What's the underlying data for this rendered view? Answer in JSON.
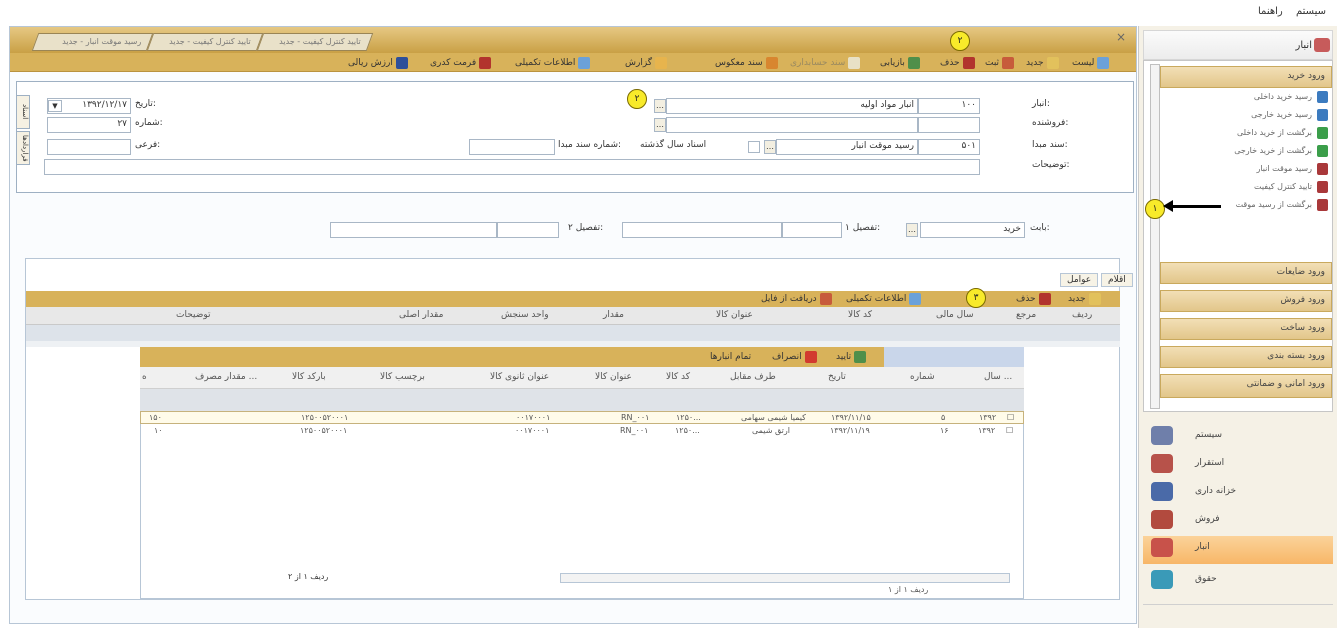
{
  "menubar": {
    "items": [
      "سیستم",
      "راهنما"
    ]
  },
  "tabs": [
    {
      "label": "رسید موقت انبار - جدید"
    },
    {
      "label": "تایید کنترل کیفیت - جدید"
    },
    {
      "label": "تایید کنترل کیفیت - جدید"
    }
  ],
  "toolbar": {
    "items": [
      "لیست",
      "جدید",
      "ثبت",
      "حذف",
      "بازیابی",
      "سند حسابداری",
      "سند معکوس",
      "گزارش",
      "اطلاعات تکمیلی",
      "فرمت کدری",
      "ارزش ریالی"
    ]
  },
  "form": {
    "labels": {
      "store": "انبار:",
      "seller": "فروشنده:",
      "source_doc": "سند مبدا:",
      "description": "توضیحات:",
      "date": "تاریخ:",
      "number": "شماره:",
      "temp": "فرعی:",
      "prev_year": "اسناد سال گذشته",
      "source_doc_num": "شماره سند مبدا:"
    },
    "store_code": "۱۰۰",
    "store_name": "انبار مواد اولیه",
    "source_code": "۵۰۱",
    "source_name": "رسید موقت انبار",
    "date": "۱۳۹۲/۱۲/۱۷",
    "number": "۲۷",
    "side_tabs": [
      "اسناد",
      "قراردادها"
    ]
  },
  "filter_row": {
    "label1": "بابت:",
    "value1": "خرید",
    "label2": "تفصیل ۱:",
    "label3": "تفصیل ۲:"
  },
  "item_tabs": [
    "اقلام",
    "عوامل"
  ],
  "grid_toolbar": {
    "items": [
      "جدید",
      "حذف",
      "اطلاعات تکمیلی",
      "دریافت از فایل"
    ]
  },
  "grid_head": [
    "ردیف",
    "مرجع",
    "سال مالی",
    "کد کالا",
    "عنوان کالا",
    "مقدار",
    "واحد سنجش",
    "مقدار اصلی",
    "توضیحات"
  ],
  "popup": {
    "toolbar": [
      "تایید",
      "انصراف",
      "تمام انبارها"
    ],
    "head": [
      "سال ...",
      "شماره",
      "تاریخ",
      "طرف مقابل",
      "کد کالا",
      "عنوان کالا",
      "عنوان ثانوی کالا",
      "برچسب کالا",
      "بارکد کالا",
      "مقدار مصرف ...",
      "ه"
    ],
    "rows": [
      {
        "year": "۱۳۹۲",
        "num": "۵",
        "date": "۱۳۹۲/۱۱/۱۵",
        "party": "کیمیا شیمی سهامی",
        "code": "۱۲۵۰...",
        "title": "RN_۰۰۱",
        "title2": "۰۰۱۷۰۰۰۱",
        "barcode": "۱۲۵۰۰۵۲۰۰۰۱",
        "qty": "۱۵۰"
      },
      {
        "year": "۱۳۹۲",
        "num": "۱۶",
        "date": "۱۳۹۲/۱۱/۱۹",
        "party": "ارتق شیمی",
        "code": "۱۲۵۰...",
        "title": "RN_۰۰۱",
        "title2": "۰۰۱۷۰۰۰۱",
        "barcode": "۱۲۵۰۰۵۲۰۰۰۱",
        "qty": "۱۰"
      }
    ],
    "pager": "ردیف ۱ از ۲"
  },
  "status": "ردیف ۱ از ۱",
  "sidebar": {
    "title": "انبار",
    "sections": [
      "ورود خرید",
      "ورود ضایعات",
      "ورود فروش",
      "ورود ساخت",
      "ورود بسته بندی",
      "ورود امانی و ضمانتی"
    ],
    "leaves": [
      "رسید خرید داخلی",
      "رسید خرید خارجی",
      "برگشت از خرید داخلی",
      "برگشت از خرید خارجی",
      "رسید موقت انبار",
      "تایید کنترل کیفیت",
      "برگشت از رسید موقت"
    ],
    "nav": [
      "سیستم",
      "استقرار",
      "خزانه داری",
      "فروش",
      "انبار",
      "حقوق"
    ]
  },
  "annotations": [
    "۱",
    "۲",
    "۲",
    "۳"
  ]
}
